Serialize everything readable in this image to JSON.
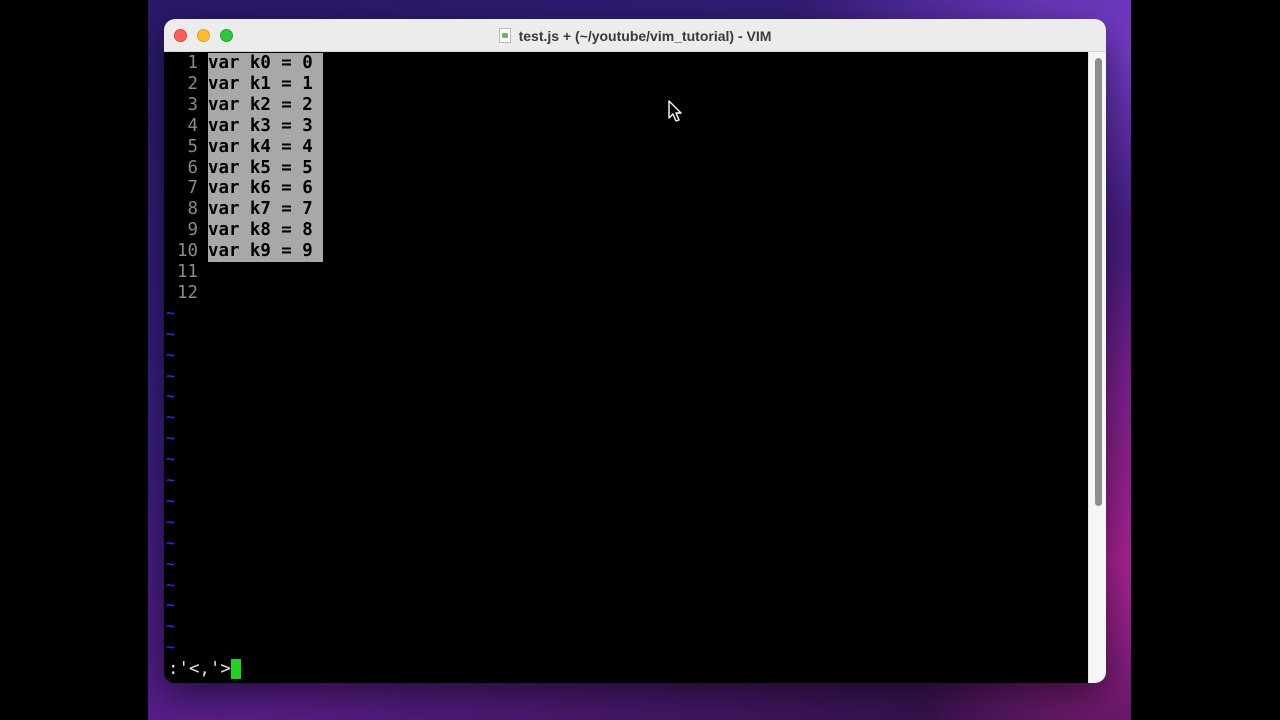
{
  "window": {
    "title": "test.js + (~/youtube/vim_tutorial) - VIM"
  },
  "editor": {
    "lines": [
      {
        "num": "1",
        "text": "var k0 = 0"
      },
      {
        "num": "2",
        "text": "var k1 = 1"
      },
      {
        "num": "3",
        "text": "var k2 = 2"
      },
      {
        "num": "4",
        "text": "var k3 = 3"
      },
      {
        "num": "5",
        "text": "var k4 = 4"
      },
      {
        "num": "6",
        "text": "var k5 = 5"
      },
      {
        "num": "7",
        "text": "var k6 = 6"
      },
      {
        "num": "8",
        "text": "var k7 = 7"
      },
      {
        "num": "9",
        "text": "var k8 = 8"
      },
      {
        "num": "10",
        "text": "var k9 = 9"
      },
      {
        "num": "11",
        "text": ""
      },
      {
        "num": "12",
        "text": ""
      }
    ],
    "tilde_glyph": "~",
    "command_line": ":'<,'>"
  },
  "colors": {
    "selection_bg": "#a8a8a8",
    "tilde": "#2b2bd6",
    "cursor": "#22d322"
  },
  "icons": [
    "close-button",
    "minimize-button",
    "maximize-button",
    "document-icon",
    "mouse-pointer-icon"
  ]
}
